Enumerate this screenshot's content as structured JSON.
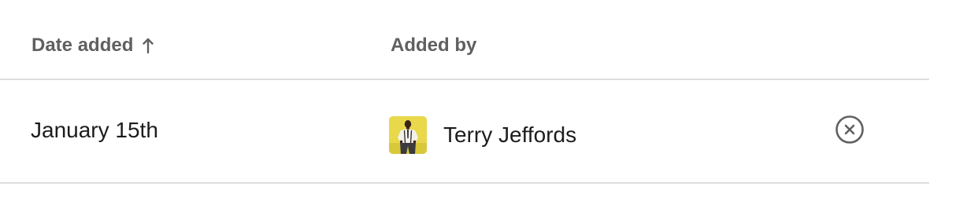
{
  "table": {
    "columns": {
      "date_added": {
        "label": "Date added",
        "sort": "ascending",
        "sort_icon": "arrow-up-icon"
      },
      "added_by": {
        "label": "Added by"
      }
    },
    "rows": [
      {
        "date": "January 15th",
        "user": {
          "name": "Terry Jeffords",
          "avatar_icon": "user-avatar"
        },
        "action_icon": "remove-circle-x-icon"
      }
    ]
  },
  "colors": {
    "header_text": "#616061",
    "body_text": "#1d1c1d",
    "divider": "#dddddd",
    "avatar_background": "#e8d84a"
  }
}
